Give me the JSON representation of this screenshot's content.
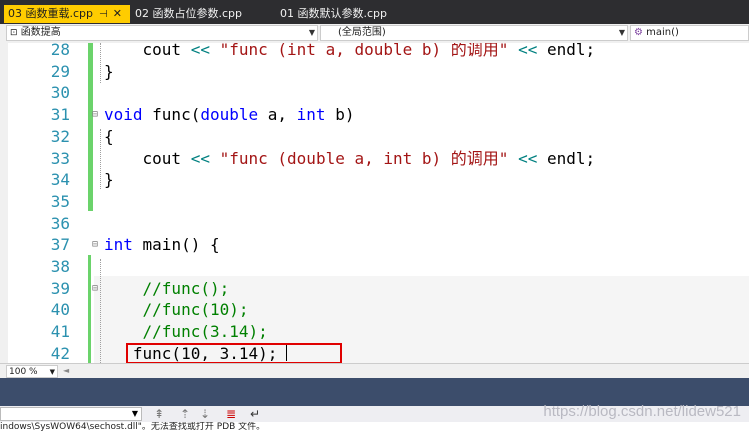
{
  "tabs": [
    {
      "label": "03 函数重载.cpp",
      "pin": "⊣",
      "close": "✕"
    },
    {
      "label": "02 函数占位参数.cpp"
    },
    {
      "label": "01 函数默认参数.cpp"
    }
  ],
  "nav": {
    "project": "函数提高",
    "scope": "(全局范围)",
    "member": "main()"
  },
  "code_lines": [
    {
      "n": "28",
      "tokens": [
        [
          "    cout ",
          ""
        ],
        [
          "<<",
          "op"
        ],
        [
          " ",
          ""
        ],
        [
          "\"func (int a, double b) 的调用\"",
          "str"
        ],
        [
          " ",
          ""
        ],
        [
          "<<",
          "op"
        ],
        [
          " endl;",
          ""
        ]
      ]
    },
    {
      "n": "29",
      "tokens": [
        [
          "}",
          ""
        ]
      ]
    },
    {
      "n": "30",
      "tokens": []
    },
    {
      "n": "31",
      "tokens": [
        [
          "void",
          "kw"
        ],
        [
          " func(",
          ""
        ],
        [
          "double",
          "kw"
        ],
        [
          " a, ",
          ""
        ],
        [
          "int",
          "kw"
        ],
        [
          " b)",
          ""
        ]
      ]
    },
    {
      "n": "32",
      "tokens": [
        [
          "{",
          ""
        ]
      ]
    },
    {
      "n": "33",
      "tokens": [
        [
          "    cout ",
          ""
        ],
        [
          "<<",
          "op"
        ],
        [
          " ",
          ""
        ],
        [
          "\"func (double a, int b) 的调用\"",
          "str"
        ],
        [
          " ",
          ""
        ],
        [
          "<<",
          "op"
        ],
        [
          " endl;",
          ""
        ]
      ]
    },
    {
      "n": "34",
      "tokens": [
        [
          "}",
          ""
        ]
      ]
    },
    {
      "n": "35",
      "tokens": []
    },
    {
      "n": "36",
      "tokens": []
    },
    {
      "n": "37",
      "tokens": [
        [
          "int",
          "kw"
        ],
        [
          " main() {",
          ""
        ]
      ]
    },
    {
      "n": "38",
      "tokens": []
    },
    {
      "n": "39",
      "tokens": [
        [
          "    //func();",
          "cm"
        ]
      ]
    },
    {
      "n": "40",
      "tokens": [
        [
          "    //func(10);",
          "cm"
        ]
      ]
    },
    {
      "n": "41",
      "tokens": [
        [
          "    //func(3.14);",
          "cm"
        ]
      ]
    },
    {
      "n": "42",
      "tokens": [
        [
          "   func(10, 3.14);",
          ""
        ]
      ]
    }
  ],
  "status": {
    "zoom": "100 %"
  },
  "output_text": "indows\\SysWOW64\\sechost.dll\"。无法查找或打开 PDB 文件。",
  "watermark": "https://blog.csdn.net/lidew521"
}
